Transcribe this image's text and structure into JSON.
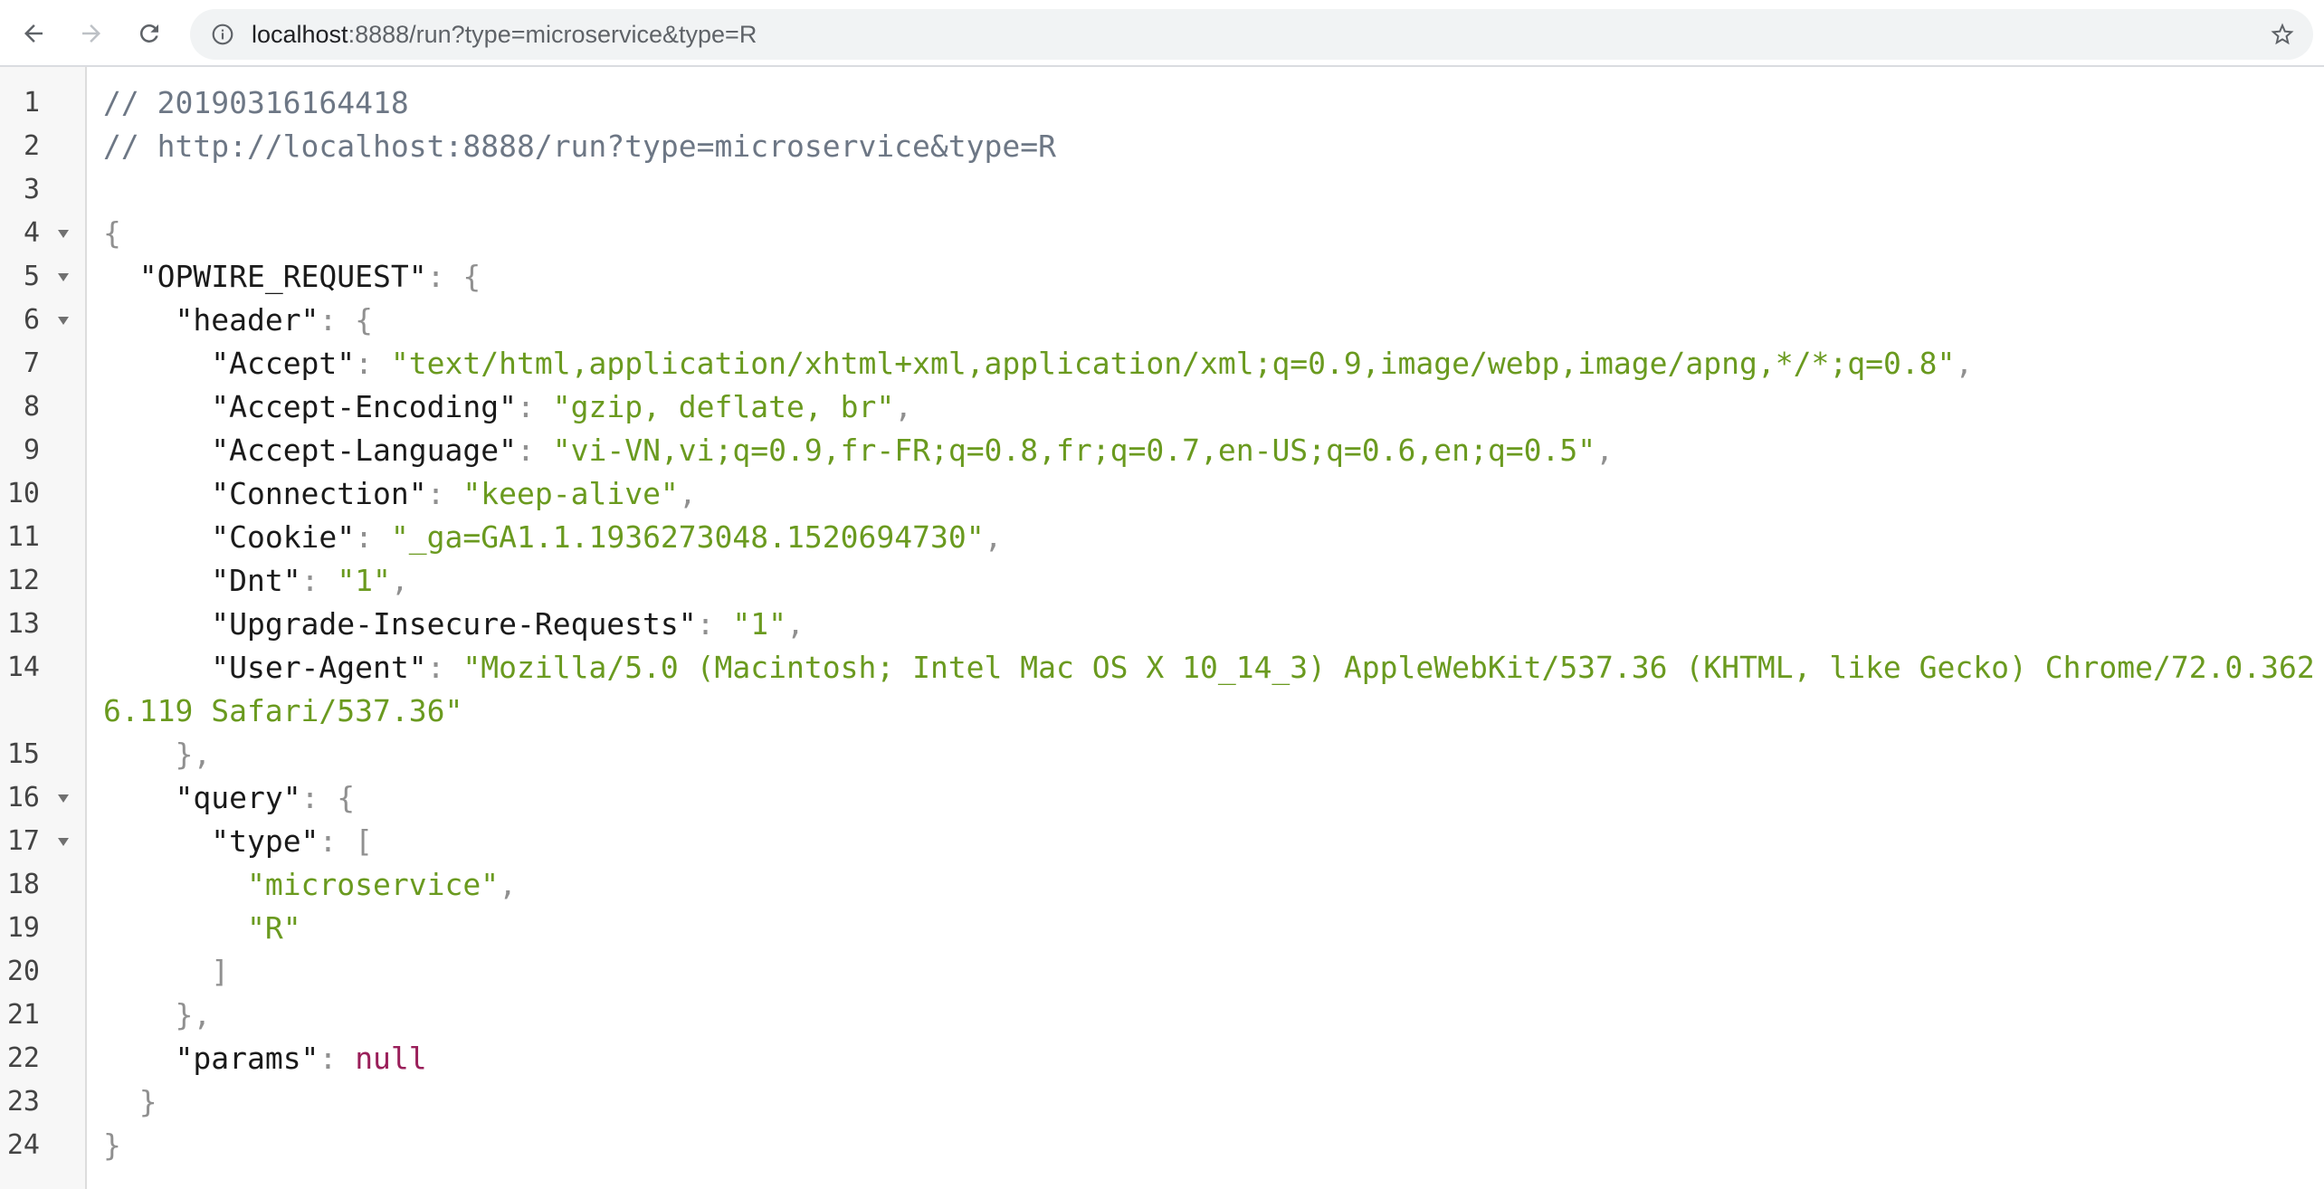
{
  "browser": {
    "url_host": "localhost",
    "url_rest": ":8888/run?type=microservice&type=R"
  },
  "icons": {
    "back": "arrow-left-icon",
    "forward": "arrow-right-icon",
    "reload": "reload-icon",
    "site_info": "info-icon",
    "bookmark": "star-icon"
  },
  "colors": {
    "string": "#6a9a1f",
    "null": "#9a1f5a",
    "comment": "#6d7785",
    "punctuation": "#909090"
  },
  "viewer": {
    "comment_timestamp": "// 20190316164418",
    "comment_url": "// http://localhost:8888/run?type=microservice&type=R",
    "root_key": "\"OPWIRE_REQUEST\"",
    "header_key": "\"header\"",
    "headers": [
      {
        "key": "\"Accept\"",
        "value": "\"text/html,application/xhtml+xml,application/xml;q=0.9,image/webp,image/apng,*/*;q=0.8\"",
        "comma": ","
      },
      {
        "key": "\"Accept-Encoding\"",
        "value": "\"gzip, deflate, br\"",
        "comma": ","
      },
      {
        "key": "\"Accept-Language\"",
        "value": "\"vi-VN,vi;q=0.9,fr-FR;q=0.8,fr;q=0.7,en-US;q=0.6,en;q=0.5\"",
        "comma": ","
      },
      {
        "key": "\"Connection\"",
        "value": "\"keep-alive\"",
        "comma": ","
      },
      {
        "key": "\"Cookie\"",
        "value": "\"_ga=GA1.1.1936273048.1520694730\"",
        "comma": ","
      },
      {
        "key": "\"Dnt\"",
        "value": "\"1\"",
        "comma": ","
      },
      {
        "key": "\"Upgrade-Insecure-Requests\"",
        "value": "\"1\"",
        "comma": ","
      },
      {
        "key": "\"User-Agent\"",
        "value": "\"Mozilla/5.0 (Macintosh; Intel Mac OS X 10_14_3) AppleWebKit/537.36 (KHTML, like Gecko) Chrome/72.0.3626.119 Safari/537.36\"",
        "comma": ""
      }
    ],
    "query_key": "\"query\"",
    "type_key": "\"type\"",
    "type_values": [
      "\"microservice\"",
      "\"R\""
    ],
    "params_key": "\"params\"",
    "params_value": "null",
    "line_numbers": [
      "1",
      "2",
      "3",
      "4",
      "5",
      "6",
      "7",
      "8",
      "9",
      "10",
      "11",
      "12",
      "13",
      "14",
      "15",
      "16",
      "17",
      "18",
      "19",
      "20",
      "21",
      "22",
      "23",
      "24"
    ]
  }
}
